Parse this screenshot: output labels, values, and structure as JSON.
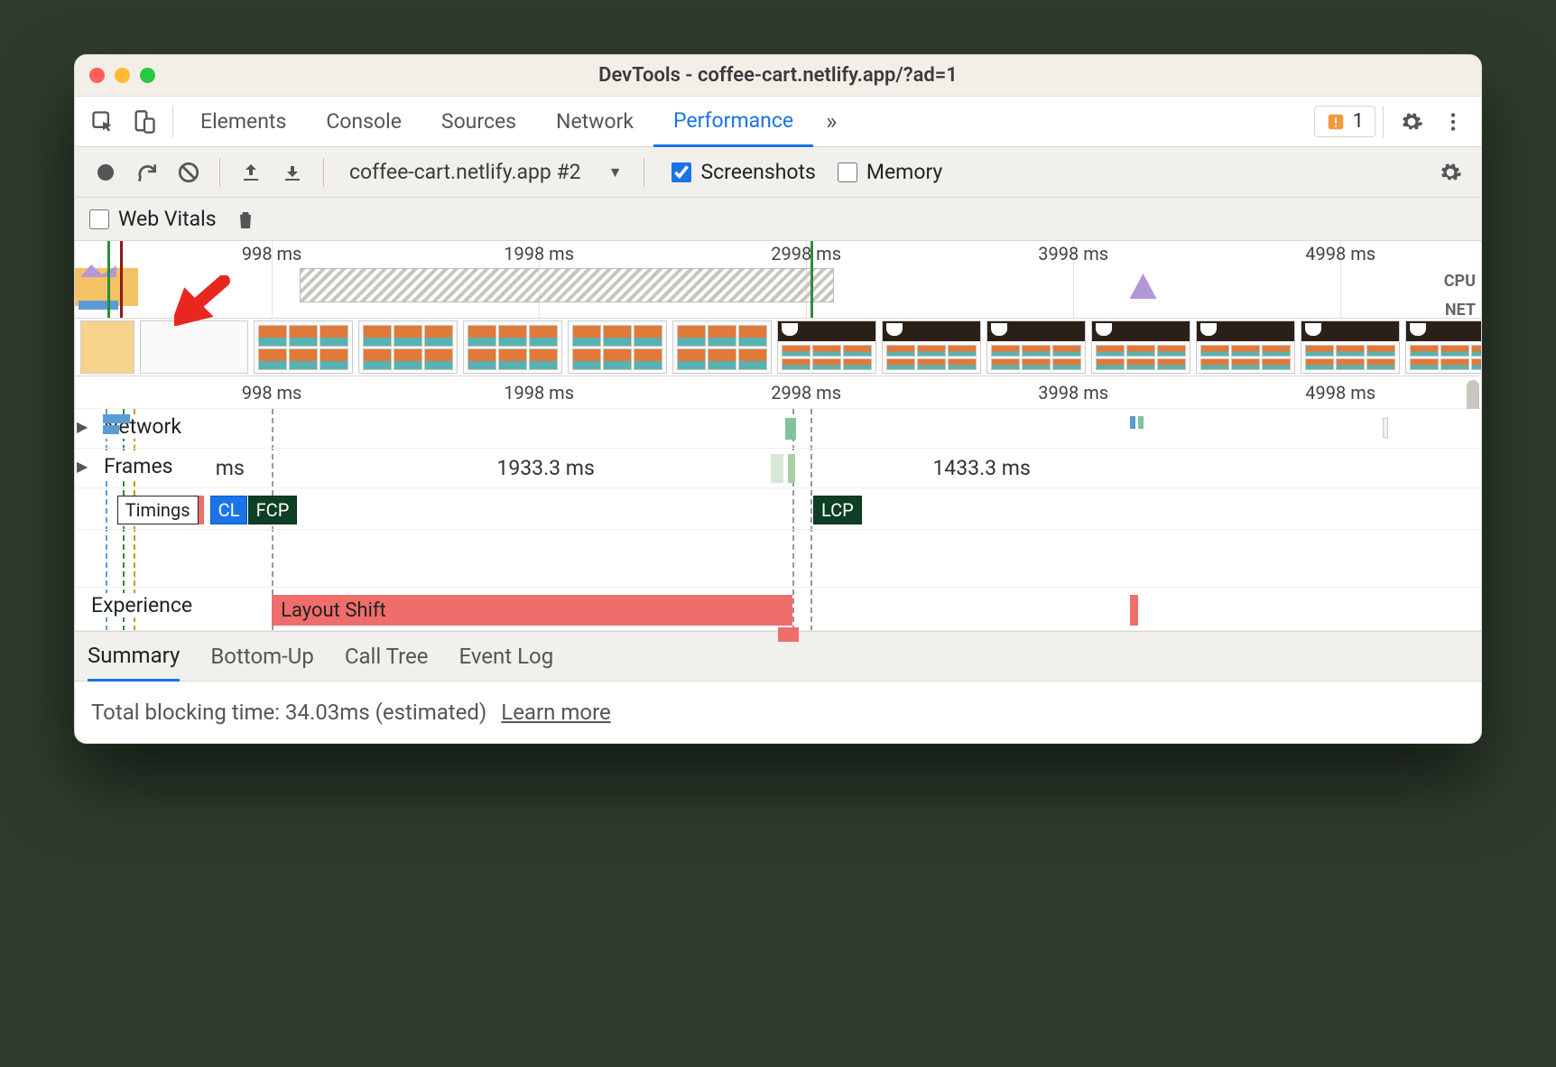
{
  "window": {
    "title": "DevTools - coffee-cart.netlify.app/?ad=1"
  },
  "tabs": {
    "items": [
      "Elements",
      "Console",
      "Sources",
      "Network",
      "Performance"
    ],
    "active": 4,
    "issues_count": "1"
  },
  "toolbar": {
    "page_select": "coffee-cart.netlify.app #2",
    "screenshots_label": "Screenshots",
    "screenshots_checked": true,
    "memory_label": "Memory",
    "memory_checked": false
  },
  "subbar": {
    "webvitals_label": "Web Vitals",
    "webvitals_checked": false
  },
  "overview": {
    "row_labels": {
      "cpu": "CPU",
      "net": "NET"
    },
    "ticks_ms": [
      "998 ms",
      "1998 ms",
      "2998 ms",
      "3998 ms",
      "4998 ms"
    ]
  },
  "ruler": {
    "ticks_ms": [
      "998 ms",
      "1998 ms",
      "2998 ms",
      "3998 ms",
      "4998 ms"
    ]
  },
  "tracks": {
    "network_label": "Network",
    "frames_label": "Frames",
    "frames_times": [
      "ms",
      "1933.3 ms",
      "1433.3 ms"
    ],
    "timings_label": "Timings",
    "timings_chips": {
      "cls": "CL",
      "fcp": "FCP",
      "lcp": "LCP"
    },
    "experience_label": "Experience",
    "experience_bar": "Layout Shift"
  },
  "bottom_tabs": {
    "items": [
      "Summary",
      "Bottom-Up",
      "Call Tree",
      "Event Log"
    ],
    "active": 0
  },
  "summary": {
    "blocking_label": "Total blocking time: 34.03ms (estimated)",
    "learn_more": "Learn more"
  }
}
